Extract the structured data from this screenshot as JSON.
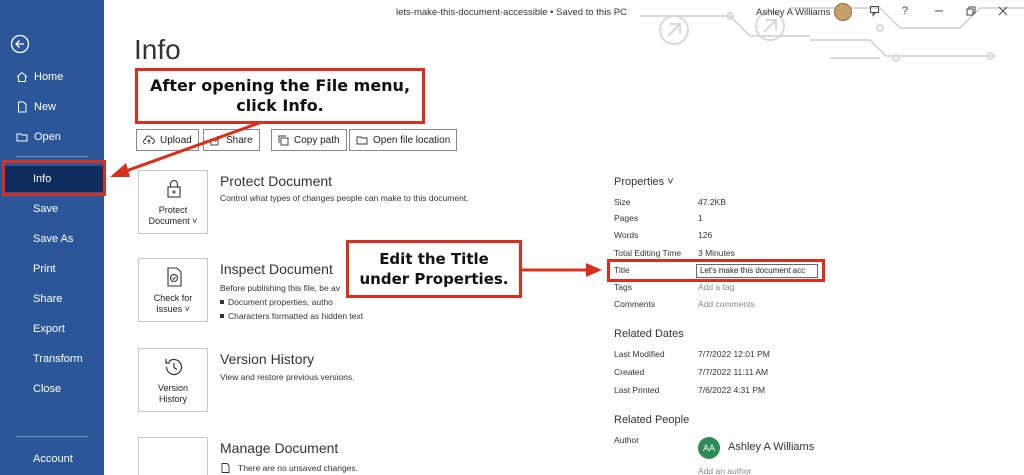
{
  "window": {
    "doc_title": "lets-make-this-document-accessible • Saved to this PC",
    "user_name": "Ashley A Williams"
  },
  "sidebar": {
    "items": [
      {
        "label": "Home",
        "icon": "home-icon"
      },
      {
        "label": "New",
        "icon": "new-doc-icon"
      },
      {
        "label": "Open",
        "icon": "folder-open-icon"
      },
      {
        "label": "Info",
        "selected": true
      },
      {
        "label": "Save"
      },
      {
        "label": "Save As"
      },
      {
        "label": "Print"
      },
      {
        "label": "Share"
      },
      {
        "label": "Export"
      },
      {
        "label": "Transform"
      },
      {
        "label": "Close"
      }
    ],
    "account": "Account"
  },
  "page_title": "Info",
  "toolbar": {
    "upload": "Upload",
    "share": "Share",
    "copy_path": "Copy path",
    "open_location": "Open file location"
  },
  "sections": {
    "protect": {
      "button_line1": "Protect",
      "button_line2": "Document ˅",
      "title": "Protect Document",
      "desc": "Control what types of changes people can make to this document."
    },
    "inspect": {
      "button_line1": "Check for",
      "button_line2": "Issues ˅",
      "title": "Inspect Document",
      "desc": "Before publishing this file, be av",
      "bullets": [
        "Document properties, autho",
        "Characters formatted as hidden text"
      ]
    },
    "version": {
      "button_line1": "Version",
      "button_line2": "History",
      "title": "Version History",
      "desc": "View and restore previous versions."
    },
    "manage": {
      "title": "Manage Document",
      "desc": "There are no unsaved changes."
    }
  },
  "properties": {
    "heading": "Properties ˅",
    "rows": [
      {
        "label": "Size",
        "value": "47.2KB"
      },
      {
        "label": "Pages",
        "value": "1"
      },
      {
        "label": "Words",
        "value": "126"
      },
      {
        "label": "Total Editing Time",
        "value": "3 Minutes"
      }
    ],
    "title_label": "Title",
    "title_value": "Let's make this document acc",
    "tags_label": "Tags",
    "tags_placeholder": "Add a tag",
    "comments_label": "Comments",
    "comments_placeholder": "Add comments"
  },
  "related_dates": {
    "heading": "Related Dates",
    "rows": [
      {
        "label": "Last Modified",
        "value": "7/7/2022 12:01 PM"
      },
      {
        "label": "Created",
        "value": "7/7/2022 11:11 AM"
      },
      {
        "label": "Last Printed",
        "value": "7/6/2022 4:31 PM"
      }
    ]
  },
  "related_people": {
    "heading": "Related People",
    "author_label": "Author",
    "author_initials": "AA",
    "author_name": "Ashley A Williams",
    "add_author": "Add an author"
  },
  "callouts": {
    "file_menu": "After opening the File menu, click Info.",
    "edit_title": "Edit the Title under Properties."
  },
  "colors": {
    "sidebar": "#2b579a",
    "selected": "#0e2d5e",
    "callout_red": "#d9301e",
    "author_avatar": "#2e8b57"
  }
}
